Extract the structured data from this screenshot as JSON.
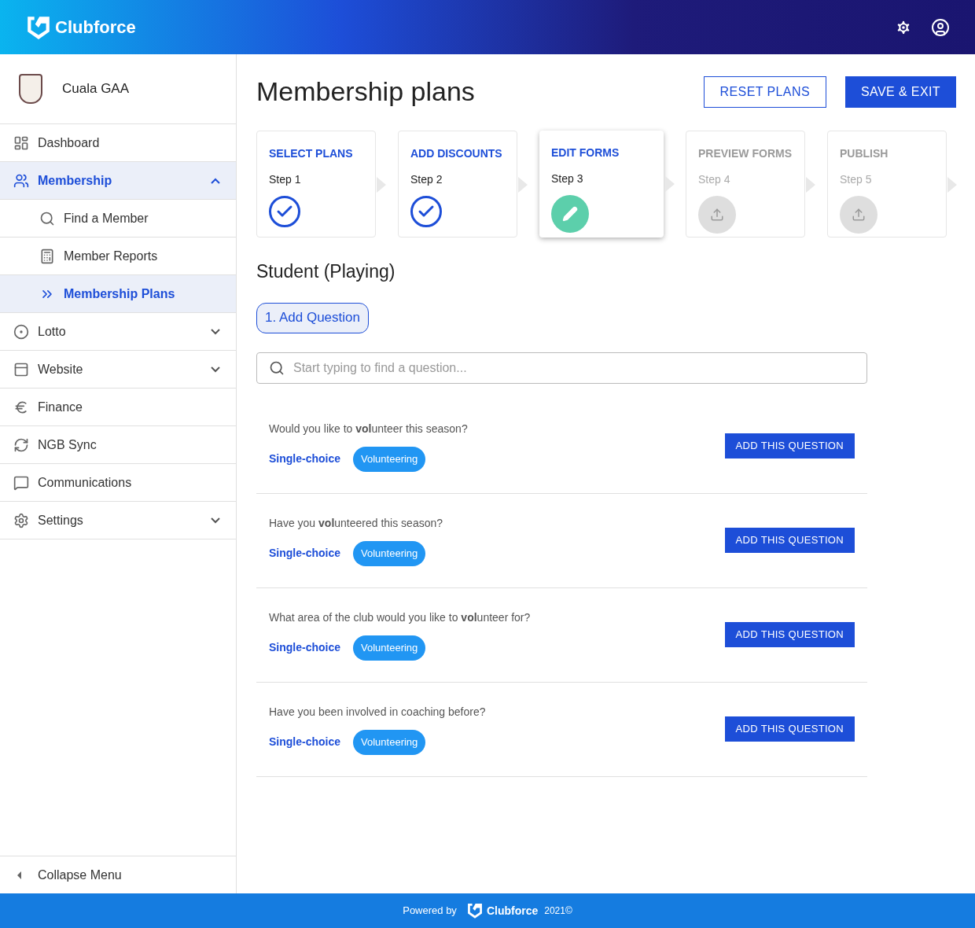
{
  "header": {
    "brand": "Clubforce"
  },
  "sidebar": {
    "club": "Cuala GAA",
    "items": [
      {
        "label": "Dashboard",
        "selected": false
      },
      {
        "label": "Membership",
        "selected": true,
        "expanded": true,
        "children": [
          {
            "label": "Find a Member",
            "selected": false
          },
          {
            "label": "Member Reports",
            "selected": false
          },
          {
            "label": "Membership Plans",
            "selected": true
          }
        ]
      },
      {
        "label": "Lotto",
        "selected": false,
        "expanded": false
      },
      {
        "label": "Website",
        "selected": false,
        "expanded": false
      },
      {
        "label": "Finance",
        "selected": false
      },
      {
        "label": "NGB Sync",
        "selected": false
      },
      {
        "label": "Communications",
        "selected": false
      },
      {
        "label": "Settings",
        "selected": false,
        "expanded": false
      }
    ],
    "collapse": "Collapse Menu"
  },
  "page": {
    "title": "Membership plans",
    "buttons": [
      {
        "label": "RESET PLANS",
        "kind": "outline"
      },
      {
        "label": "SAVE & EXIT",
        "kind": "filled"
      }
    ]
  },
  "steps": [
    {
      "title": "SELECT PLANS",
      "step": "Step 1",
      "kind": "done"
    },
    {
      "title": "ADD DISCOUNTS",
      "step": "Step 2",
      "kind": "done"
    },
    {
      "title": "EDIT FORMS",
      "step": "Step 3",
      "kind": "current"
    },
    {
      "title": "PREVIEW FORMS",
      "step": "Step 4",
      "kind": "pending"
    },
    {
      "title": "PUBLISH",
      "step": "Step 5",
      "kind": "pending"
    }
  ],
  "plan": {
    "name": "Student (Playing)",
    "add_question": "1. Add Question",
    "search": {
      "placeholder": "Start typing to find a question..."
    }
  },
  "questions": [
    {
      "text": "Would you like to **vol**unteer this season?",
      "type": "Single-choice",
      "tag": "Volunteering",
      "button": "ADD THIS QUESTION"
    },
    {
      "text": "Have you **vol**unteered this season?",
      "type": "Single-choice",
      "tag": "Volunteering",
      "button": "ADD THIS QUESTION"
    },
    {
      "text": "What area of the club would you like to **vol**unteer for?",
      "type": "Single-choice",
      "tag": "Volunteering",
      "button": "ADD THIS QUESTION"
    },
    {
      "text": "Have you been involved in coaching before?",
      "type": "Single-choice",
      "tag": "Volunteering",
      "button": "ADD THIS QUESTION"
    }
  ],
  "footer": {
    "powered": "Powered by",
    "brand": "Clubforce",
    "year": "2021©"
  }
}
